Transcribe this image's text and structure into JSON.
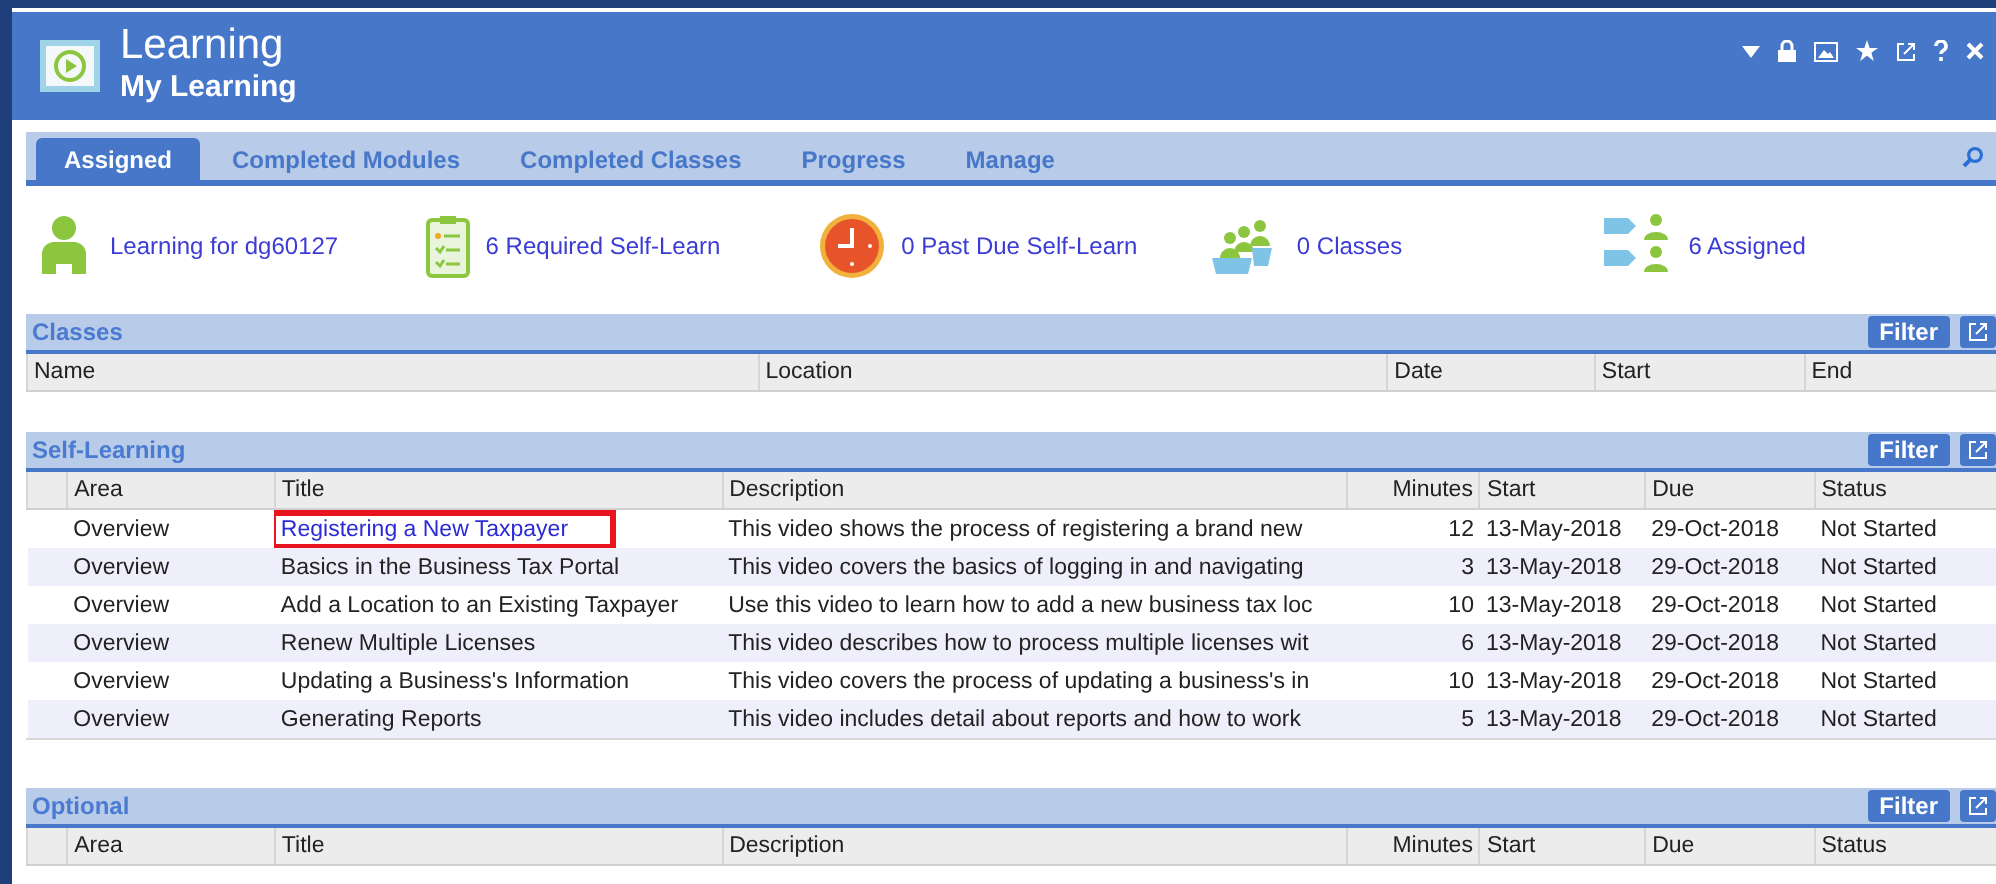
{
  "window": {
    "title": "Learning",
    "subtitle": "My Learning"
  },
  "tabs": [
    {
      "label": "Assigned",
      "selected": true
    },
    {
      "label": "Completed Modules",
      "selected": false
    },
    {
      "label": "Completed Classes",
      "selected": false
    },
    {
      "label": "Progress",
      "selected": false
    },
    {
      "label": "Manage",
      "selected": false
    }
  ],
  "summary": [
    {
      "kind": "person",
      "label": "Learning for dg60127"
    },
    {
      "kind": "checklist",
      "label": "6 Required Self-Learn"
    },
    {
      "kind": "clock",
      "label": "0 Past Due Self-Learn"
    },
    {
      "kind": "classroom",
      "label": "0 Classes"
    },
    {
      "kind": "assigned",
      "label": "6 Assigned"
    }
  ],
  "sections": [
    {
      "title": "Classes",
      "filter": "Filter",
      "columns": [
        "Name",
        "Location",
        "Date",
        "Start",
        "End"
      ]
    },
    {
      "title": "Self-Learning",
      "filter": "Filter",
      "columns": [
        "",
        "Area",
        "Title",
        "Description",
        "Minutes",
        "Start",
        "Due",
        "Status"
      ],
      "rows": [
        {
          "cells": [
            "",
            "Overview",
            "Registering a New Taxpayer",
            "This video shows the process of registering a brand new",
            "12",
            "13-May-2018",
            "29-Oct-2018",
            "Not Started"
          ],
          "highlighted": true
        },
        {
          "cells": [
            "",
            "Overview",
            "Basics in the Business Tax Portal",
            "This video covers the basics of logging in and navigating",
            "3",
            "13-May-2018",
            "29-Oct-2018",
            "Not Started"
          ],
          "highlighted": false
        },
        {
          "cells": [
            "",
            "Overview",
            "Add a Location to an Existing Taxpayer",
            "Use this video to learn how to add a new business tax loc",
            "10",
            "13-May-2018",
            "29-Oct-2018",
            "Not Started"
          ],
          "highlighted": false
        },
        {
          "cells": [
            "",
            "Overview",
            "Renew Multiple Licenses",
            "This video describes how to process multiple licenses wit",
            "6",
            "13-May-2018",
            "29-Oct-2018",
            "Not Started"
          ],
          "highlighted": false
        },
        {
          "cells": [
            "",
            "Overview",
            "Updating a Business's Information",
            "This video covers the process of updating a business's in",
            "10",
            "13-May-2018",
            "29-Oct-2018",
            "Not Started"
          ],
          "highlighted": false
        },
        {
          "cells": [
            "",
            "Overview",
            "Generating Reports",
            "This video includes detail about reports and how to work",
            "5",
            "13-May-2018",
            "29-Oct-2018",
            "Not Started"
          ],
          "highlighted": false
        }
      ]
    },
    {
      "title": "Optional",
      "filter": "Filter",
      "columns": [
        "",
        "Area",
        "Title",
        "Description",
        "Minutes",
        "Start",
        "Due",
        "Status"
      ]
    }
  ]
}
